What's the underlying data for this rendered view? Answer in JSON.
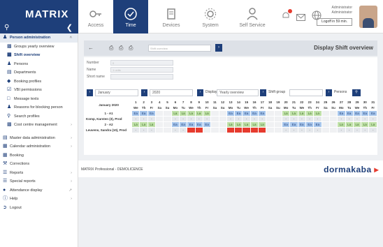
{
  "app": {
    "title": "MATRIX",
    "search_icon": "search-icon",
    "collapse_icon": "chevron-left-icon"
  },
  "nav": [
    {
      "label": "Access",
      "icon": "key-icon"
    },
    {
      "label": "Time",
      "icon": "clock-icon",
      "active": true
    },
    {
      "label": "Devices",
      "icon": "terminal-icon"
    },
    {
      "label": "System",
      "icon": "gear-icon"
    },
    {
      "label": "Self Service",
      "icon": "person-icon"
    }
  ],
  "header_icons": {
    "bell_badge": "",
    "bell": "bell-icon",
    "mail": "mail-icon",
    "globe": "globe-icon"
  },
  "user": {
    "line1": "Administrator",
    "line2": "Administrator",
    "logout": "Logoff in 59 min."
  },
  "sidebar": {
    "section": "Person administration",
    "items": [
      {
        "label": "Groups yearly overview"
      },
      {
        "label": "Shift overview",
        "selected": true
      },
      {
        "label": "Persons"
      },
      {
        "label": "Departments"
      },
      {
        "label": "Booking profiles"
      },
      {
        "label": "VBI permissions"
      },
      {
        "label": "Message texts"
      },
      {
        "label": "Reasons for blocking person"
      },
      {
        "label": "Search profiles"
      },
      {
        "label": "Cost centre management"
      }
    ],
    "bottom": [
      {
        "label": "Master data administration"
      },
      {
        "label": "Calendar administration"
      },
      {
        "label": "Booking"
      },
      {
        "label": "Corrections"
      },
      {
        "label": "Reports"
      },
      {
        "label": "Special reports"
      },
      {
        "label": "Attendance display"
      },
      {
        "label": "Help"
      },
      {
        "label": "Logout"
      }
    ]
  },
  "toolbar": {
    "back": "back-icon",
    "printer": "printer-icon",
    "mini_placeholder": "Shift overview",
    "page_title": "Display Shift overview"
  },
  "form": {
    "number_label": "Number",
    "number_value": "0",
    "name_label": "Name",
    "name_value": "1 units",
    "shortname_label": "Short name",
    "shortname_value": ""
  },
  "filters": {
    "month": "January",
    "year": "2020",
    "display_label": "Display",
    "display_value": "Yearly overview",
    "shiftgroup_label": "Shift group",
    "persons_label": "Persons"
  },
  "grid": {
    "month_label": "January 2020",
    "days": [
      "1",
      "2",
      "3",
      "4",
      "5",
      "6",
      "7",
      "8",
      "9",
      "10",
      "11",
      "12",
      "13",
      "14",
      "15",
      "16",
      "17",
      "18",
      "19",
      "20",
      "21",
      "22",
      "23",
      "24",
      "25",
      "26",
      "27",
      "28",
      "29",
      "30",
      "31"
    ],
    "weekdays": [
      "We",
      "Th",
      "Fr",
      "Sa",
      "Su",
      "Mo",
      "Tu",
      "We",
      "Th",
      "Fr",
      "Sa",
      "Su",
      "Mo",
      "Tu",
      "We",
      "Th",
      "Fr",
      "Sa",
      "Su",
      "Mo",
      "Tu",
      "We",
      "Th",
      "Fr",
      "Sa",
      "Su",
      "Mo",
      "Tu",
      "We",
      "Th",
      "Fr"
    ],
    "rows": [
      {
        "name": "1 - A1",
        "type": "shift",
        "cells": [
          "Ea",
          "Ea",
          "Ea",
          "",
          "",
          "La",
          "La",
          "La",
          "La",
          "La",
          "",
          "",
          "Ea",
          "Ea",
          "Ea",
          "Ea",
          "Ea",
          "",
          "",
          "La",
          "La",
          "La",
          "La",
          "La",
          "",
          "",
          "Ea",
          "Ea",
          "Ea",
          "Ea",
          "Ea"
        ],
        "colors": [
          "blue",
          "blue",
          "blue",
          "grey",
          "grey",
          "green",
          "green",
          "green",
          "green",
          "green",
          "grey",
          "grey",
          "blue",
          "blue",
          "blue",
          "blue",
          "blue",
          "grey",
          "grey",
          "green",
          "green",
          "green",
          "green",
          "green",
          "grey",
          "grey",
          "blue",
          "blue",
          "blue",
          "blue",
          "blue"
        ]
      },
      {
        "name": "Komp, Karsten (3), Prod",
        "type": "person",
        "cells": [
          "-",
          "-",
          "-",
          "",
          "",
          "-",
          "-",
          "-",
          "-",
          "-",
          "",
          "",
          "-",
          "-",
          "-",
          "-",
          "-",
          "",
          "",
          "-",
          "-",
          "-",
          "-",
          "-",
          "",
          "",
          "-",
          "-",
          "-",
          "-",
          "-"
        ],
        "colors": [
          "c",
          "c",
          "c",
          "grey",
          "grey",
          "c",
          "c",
          "c",
          "c",
          "c",
          "grey",
          "grey",
          "c",
          "c",
          "c",
          "c",
          "c",
          "grey",
          "grey",
          "c",
          "c",
          "c",
          "c",
          "c",
          "grey",
          "grey",
          "c",
          "c",
          "c",
          "c",
          "c"
        ]
      },
      {
        "name": "2 - A2",
        "type": "shift",
        "cells": [
          "La",
          "La",
          "La",
          "",
          "",
          "Ea",
          "Ea",
          "Ea",
          "Ea",
          "Ea",
          "",
          "",
          "La",
          "La",
          "La",
          "La",
          "La",
          "",
          "",
          "Ea",
          "Ea",
          "Ea",
          "Ea",
          "Ea",
          "",
          "",
          "La",
          "La",
          "La",
          "La",
          "La"
        ],
        "colors": [
          "green",
          "green",
          "green",
          "grey",
          "grey",
          "blue",
          "blue",
          "blue",
          "blue",
          "blue",
          "grey",
          "grey",
          "green",
          "green",
          "green",
          "green",
          "green",
          "grey",
          "grey",
          "blue",
          "blue",
          "blue",
          "blue",
          "blue",
          "grey",
          "grey",
          "green",
          "green",
          "green",
          "green",
          "green"
        ]
      },
      {
        "name": "Leuvens, Sandra (10), Prod",
        "type": "person",
        "cells": [
          "-",
          "-",
          "-",
          "",
          "",
          "-",
          "-",
          "",
          "",
          "",
          "",
          "",
          "",
          "",
          "",
          "",
          "",
          "",
          "",
          "-",
          "-",
          "-",
          "-",
          "-",
          "",
          "",
          "-",
          "-",
          "-",
          "-",
          "-"
        ],
        "colors": [
          "c",
          "c",
          "c",
          "grey",
          "grey",
          "c",
          "c",
          "red",
          "red",
          "grey",
          "grey",
          "grey",
          "red",
          "red",
          "red",
          "red",
          "red",
          "grey",
          "grey",
          "c",
          "c",
          "c",
          "c",
          "c",
          "grey",
          "grey",
          "c",
          "c",
          "c",
          "c",
          "c"
        ]
      }
    ]
  },
  "footer": {
    "copyright": "MATRIX Professional - DEMOLICENCE",
    "brand_a": "dormakaba",
    "brand_b": " ▸"
  }
}
